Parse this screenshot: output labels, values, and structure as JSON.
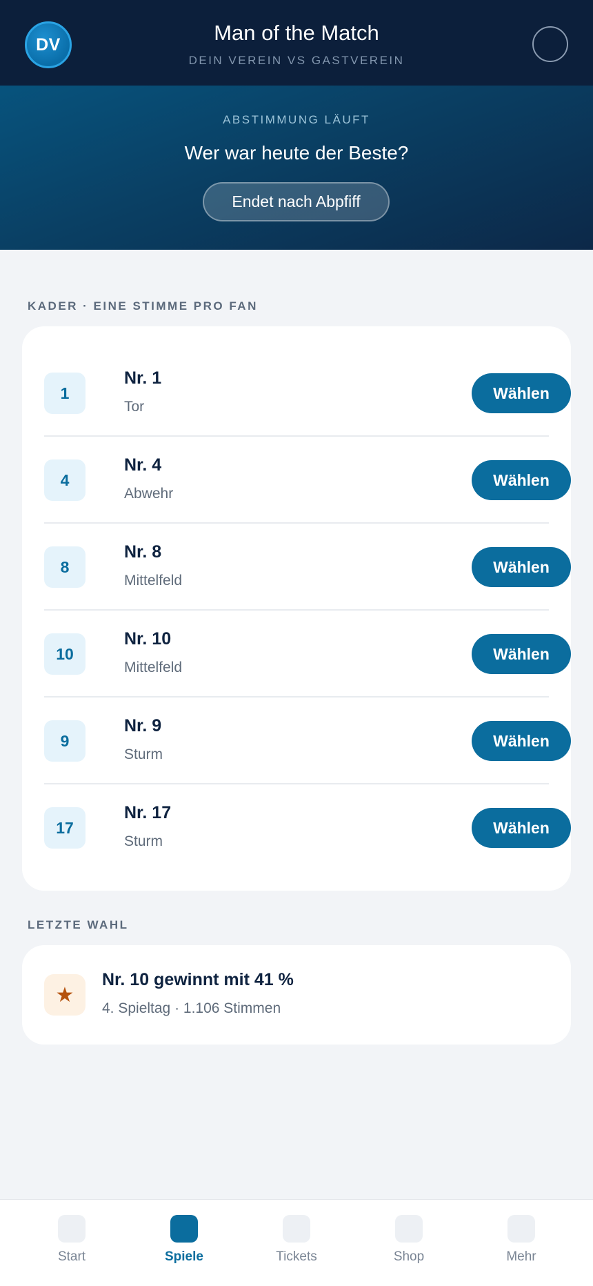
{
  "header": {
    "avatar_initials": "DV",
    "title": "Man of the Match",
    "subtitle": "DEIN VEREIN VS GASTVEREIN"
  },
  "banner": {
    "status": "ABSTIMMUNG LÄUFT",
    "question": "Wer war heute der Beste?",
    "pill": "Endet nach Abpfiff"
  },
  "squad": {
    "label": "KADER · EINE STIMME PRO FAN",
    "vote_label": "Wählen",
    "players": [
      {
        "number": "1",
        "name": "Nr. 1",
        "position": "Tor"
      },
      {
        "number": "4",
        "name": "Nr. 4",
        "position": "Abwehr"
      },
      {
        "number": "8",
        "name": "Nr. 8",
        "position": "Mittelfeld"
      },
      {
        "number": "10",
        "name": "Nr. 10",
        "position": "Mittelfeld"
      },
      {
        "number": "9",
        "name": "Nr. 9",
        "position": "Sturm"
      },
      {
        "number": "17",
        "name": "Nr. 17",
        "position": "Sturm"
      }
    ]
  },
  "last_vote": {
    "label": "LETZTE WAHL",
    "icon": "star-icon",
    "title": "Nr. 10 gewinnt mit 41 %",
    "meta": "4. Spieltag · 1.106 Stimmen"
  },
  "nav": {
    "items": [
      {
        "label": "Start",
        "active": false
      },
      {
        "label": "Spiele",
        "active": true
      },
      {
        "label": "Tickets",
        "active": false
      },
      {
        "label": "Shop",
        "active": false
      },
      {
        "label": "Mehr",
        "active": false
      }
    ]
  },
  "colors": {
    "header_bg": "#0c1f3b",
    "accent": "#0b6d9e",
    "star": "#b5520d"
  }
}
